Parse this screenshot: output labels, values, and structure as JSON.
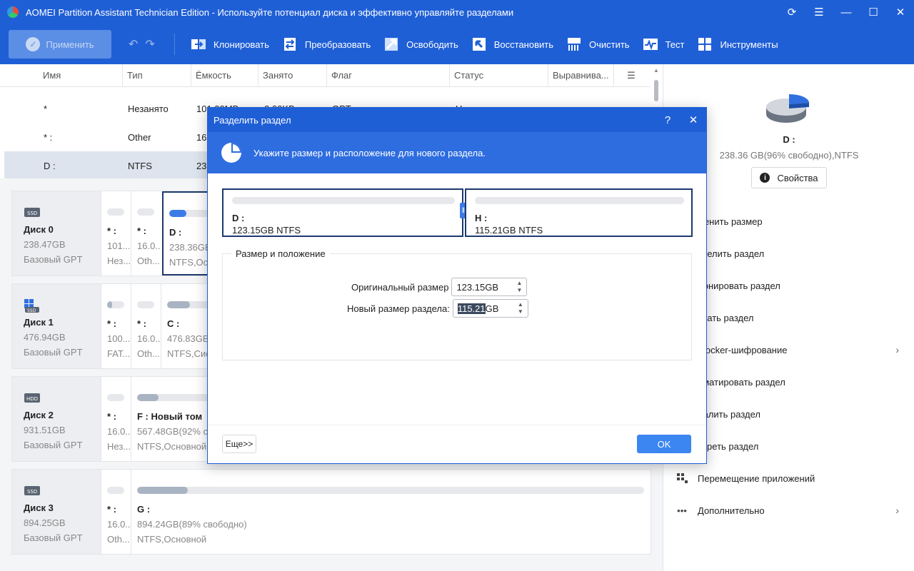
{
  "app": {
    "title": "AOMEI Partition Assistant Technician Edition - Используйте потенциал диска и эффективно управляйте разделами",
    "window_buttons": [
      "refresh-icon",
      "menu-icon",
      "minimize-icon",
      "maximize-icon",
      "close-icon"
    ]
  },
  "toolbar": {
    "apply_label": "Применить",
    "tools": [
      {
        "label": "Клонировать",
        "icon": "clone-icon"
      },
      {
        "label": "Преобразовать",
        "icon": "convert-icon"
      },
      {
        "label": "Освободить",
        "icon": "free-up-icon"
      },
      {
        "label": "Восстановить",
        "icon": "recover-icon"
      },
      {
        "label": "Очистить",
        "icon": "wipe-icon"
      },
      {
        "label": "Тест",
        "icon": "test-icon"
      },
      {
        "label": "Инструменты",
        "icon": "tools-icon"
      }
    ]
  },
  "table": {
    "columns": [
      "Имя",
      "Тип",
      "Ёмкость",
      "Занято",
      "Флаг",
      "Статус",
      "Выравнива..."
    ],
    "rows": [
      {
        "name": "*",
        "type": "Незанято",
        "capacity": "101.00MB",
        "used": "0.00KB",
        "flag": "GPT",
        "status": "Н"
      },
      {
        "name": "* :",
        "type": "Other",
        "capacity": "16.",
        "used": "",
        "flag": "",
        "status": ""
      },
      {
        "name": "D :",
        "type": "NTFS",
        "capacity": "23",
        "used": "",
        "flag": "",
        "status": ""
      }
    ]
  },
  "disks": [
    {
      "name": "Диск 0",
      "size": "238.47GB",
      "kind": "Базовый GPT",
      "icon": "ssd-disk-icon",
      "partitions": [
        {
          "name": "* :",
          "line1": "101...",
          "line2": "Нез...",
          "used_fraction": 0
        },
        {
          "name": "* :",
          "line1": "16.0...",
          "line2": "Oth...",
          "used_fraction": 0
        },
        {
          "name": "D :",
          "line1": "238.36GB",
          "line2": "NTFS,Осн",
          "used_fraction": 0.3
        }
      ]
    },
    {
      "name": "Диск 1",
      "size": "476.94GB",
      "kind": "Базовый GPT",
      "icon": "ssd-windows-disk-icon",
      "partitions": [
        {
          "name": "* :",
          "line1": "100...",
          "line2": "FAT...",
          "used_fraction": 0.3
        },
        {
          "name": "* :",
          "line1": "16.0...",
          "line2": "Oth...",
          "used_fraction": 0
        },
        {
          "name": "C :",
          "line1": "476.83GB",
          "line2": "NTFS,Сис",
          "used_fraction": 0.4
        }
      ]
    },
    {
      "name": "Диск 2",
      "size": "931.51GB",
      "kind": "Базовый GPT",
      "icon": "hdd-disk-icon",
      "partitions": [
        {
          "name": "* :",
          "line1": "16.0...",
          "line2": "Нез...",
          "used_fraction": 0
        },
        {
          "name": "F : Новый том",
          "line1": "567.48GB(92% с",
          "line2": "NTFS,Основной",
          "used_fraction": 0.25
        }
      ]
    },
    {
      "name": "Диск 3",
      "size": "894.25GB",
      "kind": "Базовый GPT",
      "icon": "ssd-disk-icon",
      "partitions": [
        {
          "name": "* :",
          "line1": "16.0...",
          "line2": "Oth...",
          "used_fraction": 0
        },
        {
          "name": "G :",
          "line1": "894.24GB(89% свободно)",
          "line2": "NTFS,Основной",
          "used_fraction": 0.1
        }
      ]
    }
  ],
  "right_panel": {
    "title": "D :",
    "subtitle": "238.36 GB(96% свободно),NTFS",
    "properties_label": "Свойства",
    "operations": [
      {
        "label": "менить размер",
        "icon": "resize-icon",
        "has_chevron": false
      },
      {
        "label": "зделить раздел",
        "icon": "split-icon",
        "has_chevron": false
      },
      {
        "label": "лонировать раздел",
        "icon": "clone-partition-icon",
        "has_chevron": false
      },
      {
        "label": "здать раздел",
        "icon": "create-partition-icon",
        "has_chevron": false
      },
      {
        "label": "tLocker-шифрование",
        "icon": "bitlocker-icon",
        "has_chevron": true
      },
      {
        "label": "рматировать раздел",
        "icon": "format-icon",
        "has_chevron": false
      },
      {
        "label": "далить раздел",
        "icon": "delete-icon",
        "has_chevron": false
      },
      {
        "label": "тереть раздел",
        "icon": "wipe-partition-icon",
        "has_chevron": false
      },
      {
        "label": "Перемещение приложений",
        "icon": "app-mover-icon",
        "has_chevron": false
      },
      {
        "label": "Дополнительно",
        "icon": "more-dots-icon",
        "has_chevron": true
      }
    ]
  },
  "dialog": {
    "title": "Разделить раздел",
    "help": "?",
    "close": "✕",
    "banner_text": "Укажите размер и расположение для нового раздела.",
    "left_part": {
      "name": "D :",
      "info": "123.15GB NTFS"
    },
    "right_part": {
      "name": "H :",
      "info": "115.21GB NTFS"
    },
    "group_label": "Размер и положение",
    "original_size_label": "Оригинальный размер",
    "original_size_value": "123.15GB",
    "new_size_label": "Новый размер раздела:",
    "new_size_number": "115.21",
    "new_size_unit": "GB",
    "more_label": "Еще>>",
    "ok_label": "OK"
  }
}
